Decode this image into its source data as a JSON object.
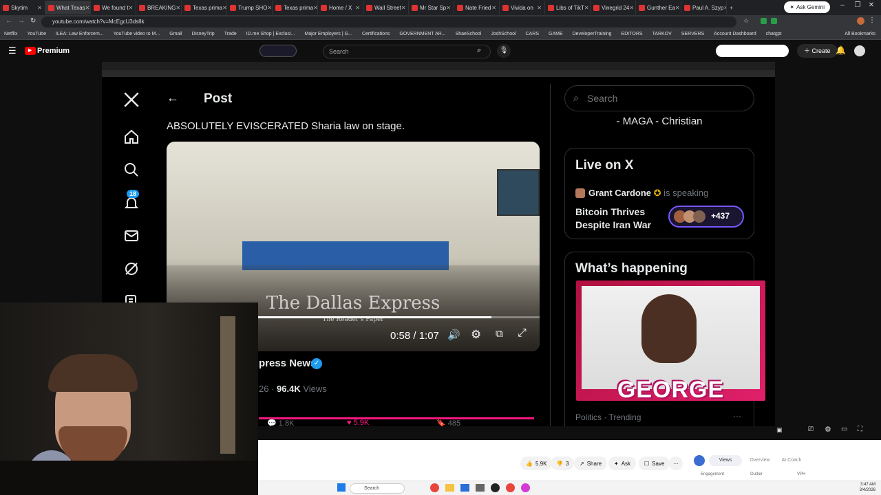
{
  "browser": {
    "tabs": [
      "Skytim",
      "What Texas",
      "We found t",
      "BREAKING",
      "Texas prima",
      "Trump SHO",
      "Texas prima",
      "Home / X",
      "Wall Street",
      "Mr Star Sp",
      "Nate Fried",
      "Vivida on",
      "Libs of TikT",
      "Vinegrid 24",
      "Gunther Ea",
      "Paul A. Szyp"
    ],
    "ask_gemini": "Ask Gemini",
    "url": "youtube.com/watch?v=McEgcU3ds8k",
    "bookmarks": [
      "Netflix",
      "YouTube",
      "ILEA: Law Enforcem...",
      "YouTube video to M...",
      "Gmail",
      "DisneyTrip",
      "Trade",
      "ID.me Shop | Exclusi...",
      "Major Employers | G...",
      "Certifications",
      "GOVERNMENT AR...",
      "ShaeSchool",
      "JoshSchool",
      "CARS",
      "GAME",
      "DeveloperTraining",
      "EDITORS",
      "TARKOV",
      "SERVERS",
      "Account Dashboard",
      "chatgpt",
      "All Bookmarks"
    ]
  },
  "youtube": {
    "logo": "Premium",
    "search_placeholder": "Search",
    "create": "Create",
    "actions": {
      "likes": "5.9K",
      "dislikes": "3",
      "share": "Share",
      "ask": "Ask",
      "save": "Save"
    },
    "studio_tabs": [
      "Views",
      "Overview",
      "AI Coach"
    ],
    "studio_sub": [
      "Engagement",
      "Outlier",
      "VPH"
    ]
  },
  "x": {
    "post_title": "Post",
    "tweet_text": "ABSOLUTELY EVISCERATED Sharia law on stage.",
    "notification_count": "18",
    "video": {
      "time": "0:58 / 1:07",
      "watermark": "The Dallas Express",
      "watermark_sub": "The Reader's Paper"
    },
    "author": "press News",
    "views_prefix": "26 · ",
    "views_count": "96.4K",
    "views_label": " Views",
    "stats": {
      "replies": "1.8K",
      "likes": "5.9K",
      "bookmarks": "485"
    },
    "search_placeholder": "Search",
    "bio_line": "- MAGA - Christian",
    "live": {
      "heading": "Live on X",
      "host": "Grant Cardone",
      "speaking": "is speaking",
      "topic_1": "Bitcoin Thrives",
      "topic_2": "Despite Iran War",
      "listeners": "+437"
    },
    "happening": {
      "heading": "What’s happening",
      "thumb_text": "GEORGE",
      "category": "Politics · Trending"
    }
  },
  "taskbar": {
    "search": "Search",
    "time": "3:47 AM",
    "date": "3/4/2026"
  },
  "colors": {
    "x_blue": "#1d9bf0",
    "yt_red": "#ff0000",
    "like_pink": "#f91880",
    "live_purple": "#7856ff"
  }
}
